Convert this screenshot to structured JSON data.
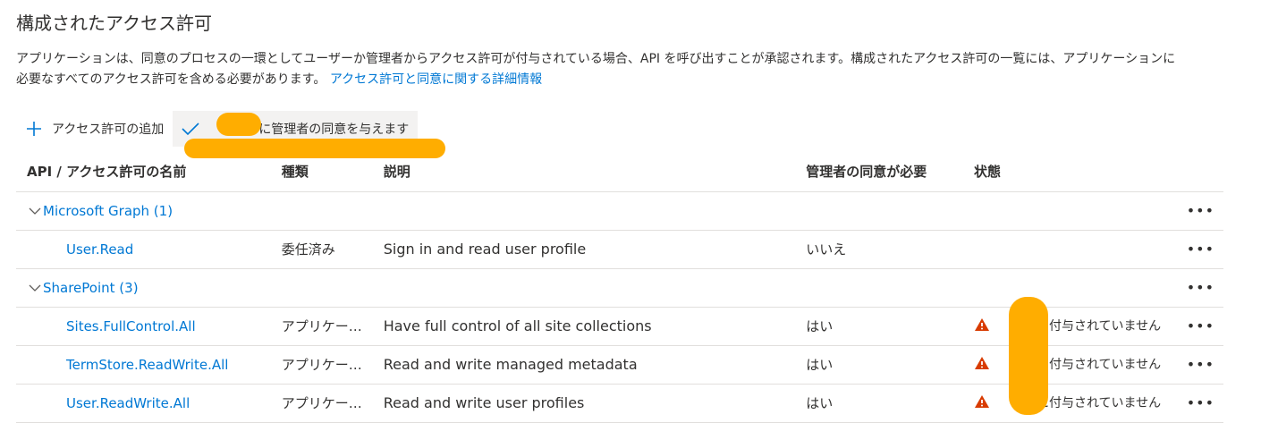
{
  "page": {
    "title": "構成されたアクセス許可",
    "description_line1": "アプリケーションは、同意のプロセスの一環としてユーザーか管理者からアクセス許可が付与されている場合、API を呼び出すことが承認されます。構成されたアクセス許可の一覧には、アプリケーションに",
    "description_line2": "必要なすべてのアクセス許可を含める必要があります。",
    "learn_more_link": "アクセス許可と同意に関する詳細情報"
  },
  "toolbar": {
    "add_permission": "アクセス許可の追加",
    "grant_consent_suffix": "に管理者の同意を与えます"
  },
  "table": {
    "headers": {
      "name": "API / アクセス許可の名前",
      "type": "種類",
      "description": "説明",
      "admin_consent": "管理者の同意が必要",
      "status": "状態"
    },
    "groups": [
      {
        "label": "Microsoft Graph (1)",
        "rows": [
          {
            "name": "User.Read",
            "type": "委任済み",
            "description": "Sign in and read user profile",
            "admin_consent": "いいえ",
            "status": ""
          }
        ]
      },
      {
        "label": "SharePoint (3)",
        "rows": [
          {
            "name": "Sites.FullControl.All",
            "type": "アプリケー…",
            "description": "Have full control of all site collections",
            "admin_consent": "はい",
            "status": "に付与されていません"
          },
          {
            "name": "TermStore.ReadWrite.All",
            "type": "アプリケー…",
            "description": "Read and write managed metadata",
            "admin_consent": "はい",
            "status": "に付与されていません"
          },
          {
            "name": "User.ReadWrite.All",
            "type": "アプリケー…",
            "description": "Read and write user profiles",
            "admin_consent": "はい",
            "status": "に付与されていません"
          }
        ]
      }
    ],
    "more_actions": "•••"
  },
  "colors": {
    "accent": "#0078d4",
    "warning": "#d83b01",
    "redaction": "#ffad00",
    "text": "#323130",
    "divider": "#e1dfdd"
  }
}
